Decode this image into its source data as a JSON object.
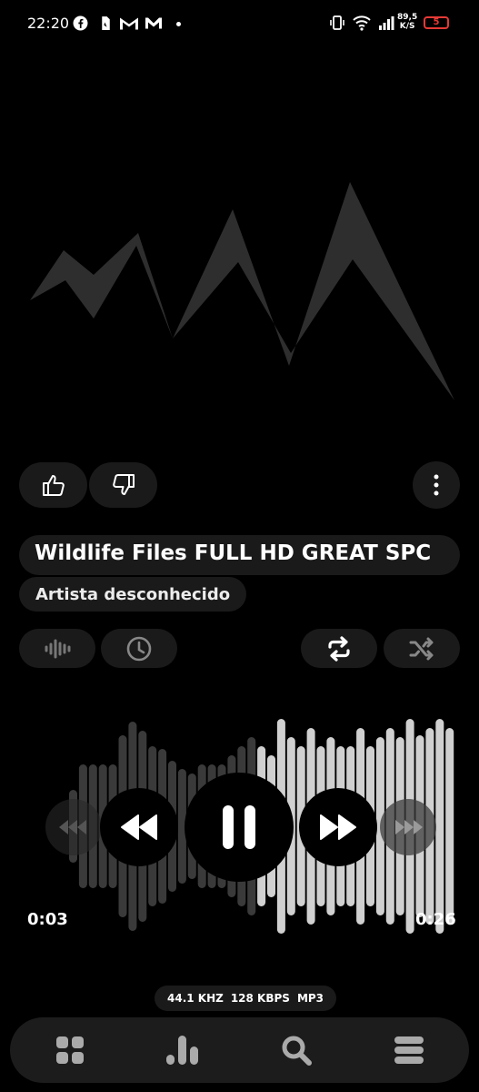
{
  "status_bar": {
    "time": "22:20",
    "net_speed_value": "89,5",
    "net_speed_unit": "K/S",
    "battery_level": "5"
  },
  "track": {
    "title": "Wildlife Files FULL HD GREAT SPC",
    "artist": "Artista desconhecido",
    "elapsed": "0:03",
    "duration": "0:26"
  },
  "audio_info": {
    "sample_rate": "44.1 KHZ",
    "bitrate": "128 KBPS",
    "format": "MP3"
  },
  "colors": {
    "background": "#000000",
    "surface": "#1a1a1a",
    "waveform_played": "#d0d0d0",
    "waveform_unplayed": "#3a3a3a",
    "battery_low": "#e53935"
  },
  "playback": {
    "state": "playing",
    "progress_fraction": 0.115
  },
  "icons": {
    "like": "thumbs-up-icon",
    "dislike": "thumbs-down-icon",
    "more": "more-vertical-icon",
    "visualizer": "waveform-icon",
    "timer": "clock-icon",
    "repeat": "repeat-icon",
    "shuffle": "shuffle-icon",
    "previous_album": "triple-rewind-icon",
    "rewind": "rewind-icon",
    "pause": "pause-icon",
    "fast_forward": "fast-forward-icon",
    "next_album": "triple-forward-icon",
    "nav_library": "grid-icon",
    "nav_stats": "bar-chart-icon",
    "nav_search": "search-icon",
    "nav_menu": "menu-icon"
  }
}
